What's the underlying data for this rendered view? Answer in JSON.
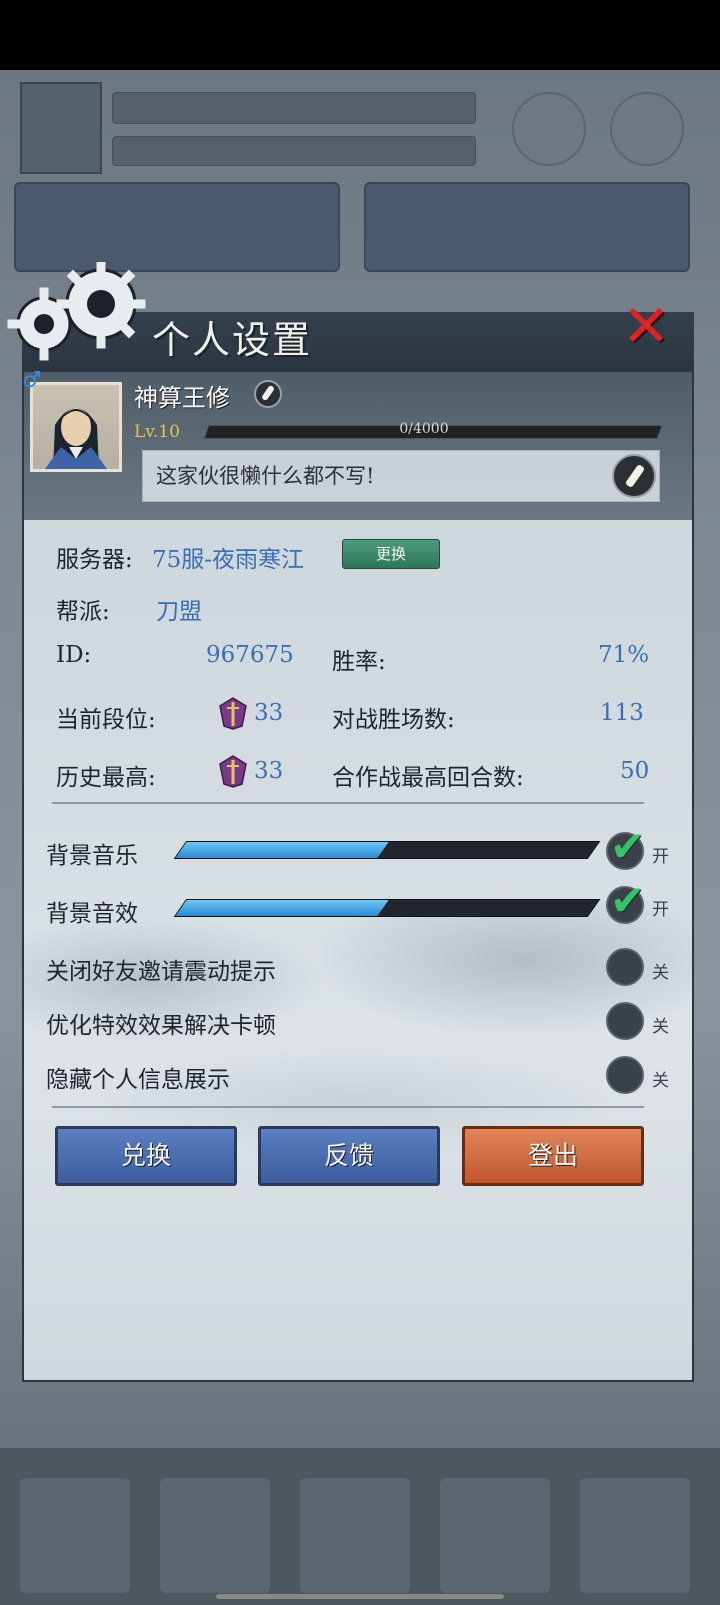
{
  "dialog": {
    "title": "个人设置"
  },
  "profile": {
    "name": "神算王修",
    "level": "Lv.10",
    "exp": "0/4000",
    "exp_progress": 0,
    "signature": "这家伙很懒什么都不写!"
  },
  "info": {
    "server_label": "服务器:",
    "server_value": "75服-夜雨寒江",
    "change_button": "更换",
    "guild_label": "帮派:",
    "guild_value": "刀盟",
    "id_label": "ID:",
    "id_value": "967675",
    "winrate_label": "胜率:",
    "winrate_value": "71%",
    "rank_label": "当前段位:",
    "rank_value": "33",
    "wins_label": "对战胜场数:",
    "wins_value": "113",
    "best_label": "历史最高:",
    "best_value": "33",
    "coop_label": "合作战最高回合数:",
    "coop_value": "50"
  },
  "settings": {
    "bgm": {
      "label": "背景音乐",
      "level": 0.49,
      "state": "开",
      "enabled": true
    },
    "sfx": {
      "label": "背景音效",
      "level": 0.49,
      "state": "开",
      "enabled": true
    },
    "toggles": [
      {
        "label": "关闭好友邀请震动提示",
        "state": "关",
        "enabled": false
      },
      {
        "label": "优化特效效果解决卡顿",
        "state": "关",
        "enabled": false
      },
      {
        "label": "隐藏个人信息展示",
        "state": "关",
        "enabled": false
      }
    ]
  },
  "buttons": {
    "redeem": "兑换",
    "feedback": "反馈",
    "logout": "登出"
  },
  "colors": {
    "accent_blue": "#3a6fb5",
    "logout_orange": "#c1562f",
    "check_green": "#39c06b",
    "close_red": "#d8252a"
  }
}
